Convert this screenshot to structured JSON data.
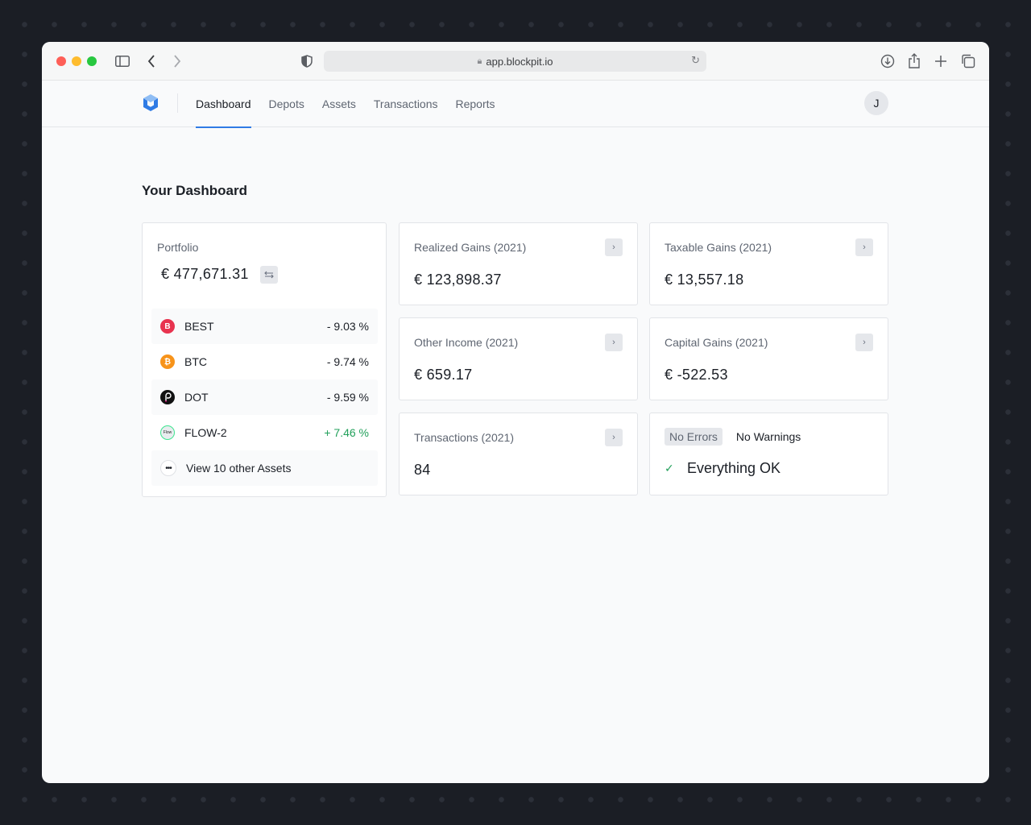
{
  "browser": {
    "url": "app.blockpit.io",
    "traffic_colors": {
      "close": "#fe5f57",
      "minimize": "#febc2e",
      "zoom": "#28c840"
    }
  },
  "nav": {
    "tabs": [
      {
        "label": "Dashboard",
        "active": true
      },
      {
        "label": "Depots",
        "active": false
      },
      {
        "label": "Assets",
        "active": false
      },
      {
        "label": "Transactions",
        "active": false
      },
      {
        "label": "Reports",
        "active": false
      }
    ],
    "avatar_initial": "J",
    "accent": "#2f7be5"
  },
  "page": {
    "title": "Your Dashboard"
  },
  "portfolio": {
    "label": "Portfolio",
    "value": "€ 477,671.31",
    "assets": [
      {
        "symbol": "BEST",
        "change": "- 9.03 %",
        "icon": "bitpanda-best-icon",
        "color": "#e8334f",
        "glyph": "B"
      },
      {
        "symbol": "BTC",
        "change": "- 9.74 %",
        "icon": "bitcoin-icon",
        "color": "#f7931a",
        "glyph": "₿"
      },
      {
        "symbol": "DOT",
        "change": "- 9.59 %",
        "icon": "polkadot-icon",
        "color": "#111111",
        "glyph": "P"
      },
      {
        "symbol": "FLOW-2",
        "change": "+ 7.46 %",
        "icon": "flow-icon",
        "color": "#e9ecef",
        "glyph": "Flow"
      }
    ],
    "more_label": "View 10 other Assets"
  },
  "cards": {
    "realized": {
      "label": "Realized Gains (2021)",
      "value": "€ 123,898.37"
    },
    "taxable": {
      "label": "Taxable Gains (2021)",
      "value": "€ 13,557.18"
    },
    "other_income": {
      "label": "Other Income (2021)",
      "value": "€ 659.17"
    },
    "capital": {
      "label": "Capital Gains (2021)",
      "value": "€ -522.53"
    },
    "transactions": {
      "label": "Transactions (2021)",
      "value": "84"
    },
    "status": {
      "errors": "No Errors",
      "warnings": "No Warnings",
      "ok_text": "Everything OK"
    }
  }
}
